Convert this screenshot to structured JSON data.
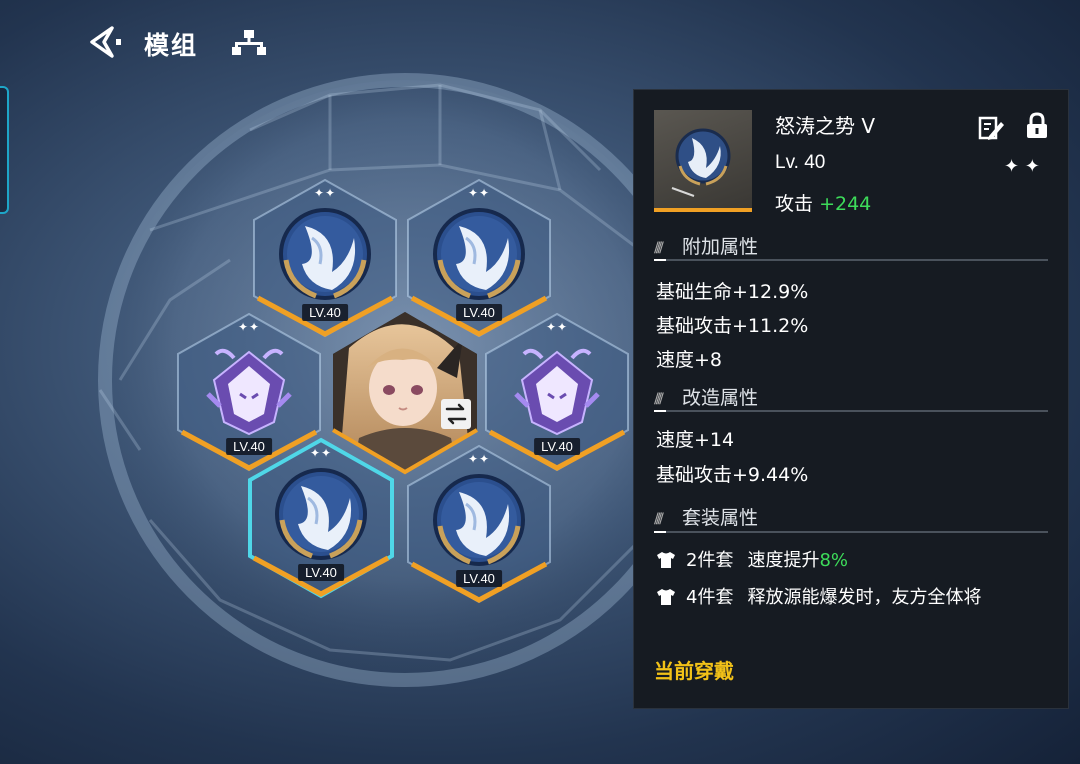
{
  "header": {
    "title": "模组"
  },
  "slots": [
    {
      "level": "LV.40",
      "type": "blue",
      "stars": "✦✦"
    },
    {
      "level": "LV.40",
      "type": "blue",
      "stars": "✦✦"
    },
    {
      "level": "LV.40",
      "type": "purple",
      "stars": "✦✦"
    },
    {
      "level": "LV.40",
      "type": "purple",
      "stars": "✦✦"
    },
    {
      "level": "LV.40",
      "type": "blue",
      "stars": "✦✦",
      "selected": true
    },
    {
      "level": "LV.40",
      "type": "blue",
      "stars": "✦✦"
    }
  ],
  "detail": {
    "name": "怒涛之势 V",
    "level": "Lv. 40",
    "main_stat_label": "攻击",
    "main_stat_value": "+244",
    "rarity_stars": "✦ ✦",
    "sections": {
      "bonus": "附加属性",
      "modify": "改造属性",
      "set": "套装属性"
    },
    "bonus_attrs": [
      "基础生命+12.9%",
      "基础攻击+11.2%",
      "速度+8"
    ],
    "modify_attrs": [
      "速度+14",
      "基础攻击+9.44%"
    ],
    "set_bonuses": [
      {
        "count": "2件套",
        "text": "速度提升",
        "value": "8%"
      },
      {
        "count": "4件套",
        "text": "释放源能爆发时，友方全体将",
        "value": ""
      }
    ],
    "equipped_label": "当前穿戴"
  },
  "colors": {
    "accent_orange": "#f0a024",
    "selected_cyan": "#4fd7e8",
    "green": "#3ddc5a",
    "gold": "#f2c218"
  }
}
